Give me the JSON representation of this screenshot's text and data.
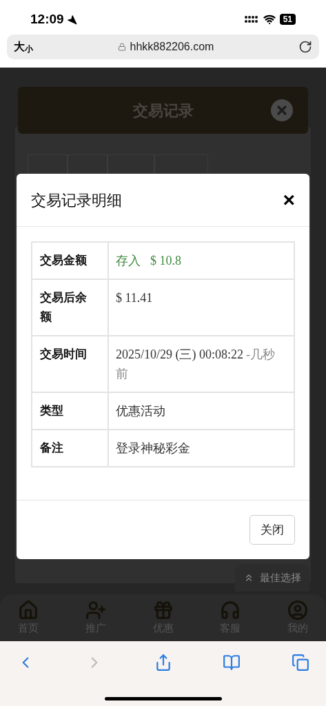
{
  "status_bar": {
    "time": "12:09",
    "battery": "51"
  },
  "address_bar": {
    "text_size_large": "大",
    "text_size_small": "小",
    "url": "hhkk882206.com"
  },
  "page": {
    "title": "交易记录"
  },
  "dialog": {
    "title": "交易记录明细",
    "close_symbol": "×",
    "rows": [
      {
        "label": "交易金额",
        "parts": [
          {
            "kind": "deposit",
            "text": "存入"
          },
          {
            "kind": "deposit",
            "text": "$ 10.8"
          }
        ]
      },
      {
        "label": "交易后余额",
        "parts": [
          {
            "kind": "plain",
            "text": "$ 11.41"
          }
        ]
      },
      {
        "label": "交易时间",
        "parts": [
          {
            "kind": "plain",
            "text": "2025/10/29 (三) 00:08:22"
          },
          {
            "kind": "relative",
            "text": "-几秒前"
          }
        ]
      },
      {
        "label": "类型",
        "parts": [
          {
            "kind": "plain",
            "text": "优惠活动"
          }
        ]
      },
      {
        "label": "备注",
        "parts": [
          {
            "kind": "plain",
            "text": "登录神秘彩金"
          }
        ]
      }
    ],
    "button": "关闭"
  },
  "best_choice_button": "最佳选择",
  "bottom_nav": [
    {
      "kind": "home",
      "label": "首页"
    },
    {
      "kind": "invite",
      "label": "推广"
    },
    {
      "kind": "gift",
      "label": "优惠"
    },
    {
      "kind": "support",
      "label": "客服"
    },
    {
      "kind": "profile",
      "label": "我的"
    }
  ],
  "browser_toolbar": [
    {
      "kind": "back",
      "disabled": false
    },
    {
      "kind": "forward",
      "disabled": true
    },
    {
      "kind": "share",
      "disabled": false
    },
    {
      "kind": "bookmarks",
      "disabled": false
    },
    {
      "kind": "tabs",
      "disabled": false
    }
  ]
}
